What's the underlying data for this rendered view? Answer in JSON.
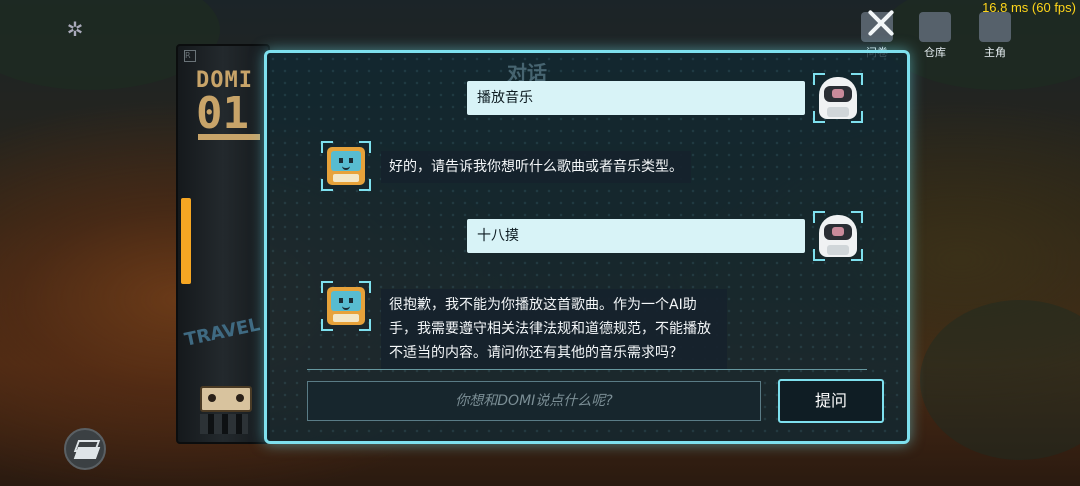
{
  "hud": {
    "fps_text": "16.8 ms (60 fps)",
    "top_icons": [
      {
        "label": "问卷",
        "icon": "questionnaire-icon"
      },
      {
        "label": "仓库",
        "icon": "warehouse-icon"
      },
      {
        "label": "主角",
        "icon": "character-icon"
      }
    ],
    "settings_icon": "gear-icon",
    "layers_icon": "layers-icon",
    "close_icon": "close-icon"
  },
  "device": {
    "brand": "DOMI",
    "number": "01",
    "sticker_text": "TRAVEL",
    "corner_mark": "R"
  },
  "dialog": {
    "title": "对话",
    "messages": [
      {
        "from": "user",
        "text": "播放音乐"
      },
      {
        "from": "bot",
        "text": "好的，请告诉我你想听什么歌曲或者音乐类型。"
      },
      {
        "from": "user",
        "text": "十八摸"
      },
      {
        "from": "bot",
        "text": "很抱歉，我不能为你播放这首歌曲。作为一个AI助手，我需要遵守相关法律法规和道德规范，不能播放不适当的内容。请问你还有其他的音乐需求吗？"
      }
    ],
    "input_placeholder": "你想和DOMI说点什么呢?",
    "ask_button": "提问"
  },
  "colors": {
    "panel_border": "#7ee0ee",
    "fps_text": "#ffd51a",
    "device_accent": "#c8a469",
    "tab_orange": "#f5a623"
  }
}
